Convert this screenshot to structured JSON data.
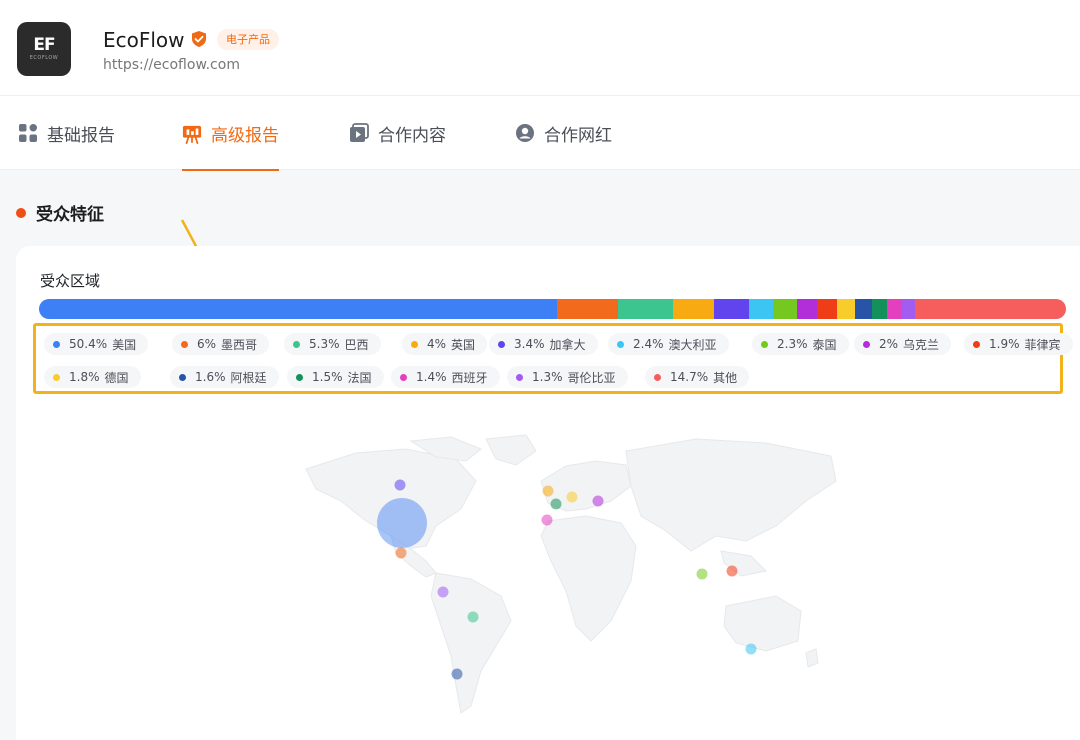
{
  "brand": {
    "logo_text": "EF",
    "logo_subtext": "ECOFLOW",
    "name": "EcoFlow",
    "category_tag": "电子产品",
    "url": "https://ecoflow.com"
  },
  "tabs": [
    {
      "label": "基础报告",
      "icon": "grid-icon",
      "active": false
    },
    {
      "label": "高级报告",
      "icon": "presentation-icon",
      "active": true
    },
    {
      "label": "合作内容",
      "icon": "video-icon",
      "active": false
    },
    {
      "label": "合作网红",
      "icon": "user-icon",
      "active": false
    }
  ],
  "section": {
    "title": "受众特征"
  },
  "audience_region": {
    "title": "受众区域",
    "items": [
      {
        "pct": "50.4%",
        "value": 50.4,
        "name": "美国",
        "color": "#3d7ff5"
      },
      {
        "pct": "6%",
        "value": 6,
        "name": "墨西哥",
        "color": "#f26a1b"
      },
      {
        "pct": "5.3%",
        "value": 5.3,
        "name": "巴西",
        "color": "#3cc58e"
      },
      {
        "pct": "4%",
        "value": 4,
        "name": "英国",
        "color": "#f7aa11"
      },
      {
        "pct": "3.4%",
        "value": 3.4,
        "name": "加拿大",
        "color": "#6244ef"
      },
      {
        "pct": "2.4%",
        "value": 2.4,
        "name": "澳大利亚",
        "color": "#3cc4f3"
      },
      {
        "pct": "2.3%",
        "value": 2.3,
        "name": "泰国",
        "color": "#74c81f"
      },
      {
        "pct": "2%",
        "value": 2,
        "name": "乌克兰",
        "color": "#b12ed9"
      },
      {
        "pct": "1.9%",
        "value": 1.9,
        "name": "菲律宾",
        "color": "#ef3d17"
      },
      {
        "pct": "1.8%",
        "value": 1.8,
        "name": "德国",
        "color": "#f8cc2a"
      },
      {
        "pct": "1.6%",
        "value": 1.6,
        "name": "阿根廷",
        "color": "#2854a8"
      },
      {
        "pct": "1.5%",
        "value": 1.5,
        "name": "法国",
        "color": "#14905a"
      },
      {
        "pct": "1.4%",
        "value": 1.4,
        "name": "西班牙",
        "color": "#e33fbf"
      },
      {
        "pct": "1.3%",
        "value": 1.3,
        "name": "哥伦比亚",
        "color": "#a35cf0"
      },
      {
        "pct": "14.7%",
        "value": 14.7,
        "name": "其他",
        "color": "#f65d5d"
      }
    ]
  },
  "chart_data": {
    "type": "bar",
    "title": "受众区域",
    "categories": [
      "美国",
      "墨西哥",
      "巴西",
      "英国",
      "加拿大",
      "澳大利亚",
      "泰国",
      "乌克兰",
      "菲律宾",
      "德国",
      "阿根廷",
      "法国",
      "西班牙",
      "哥伦比亚",
      "其他"
    ],
    "values": [
      50.4,
      6,
      5.3,
      4,
      3.4,
      2.4,
      2.3,
      2,
      1.9,
      1.8,
      1.6,
      1.5,
      1.4,
      1.3,
      14.7
    ],
    "unit": "%",
    "stacked_100": true
  },
  "colors": {
    "accent": "#f06a16",
    "highlight_box": "#f2b21a"
  }
}
